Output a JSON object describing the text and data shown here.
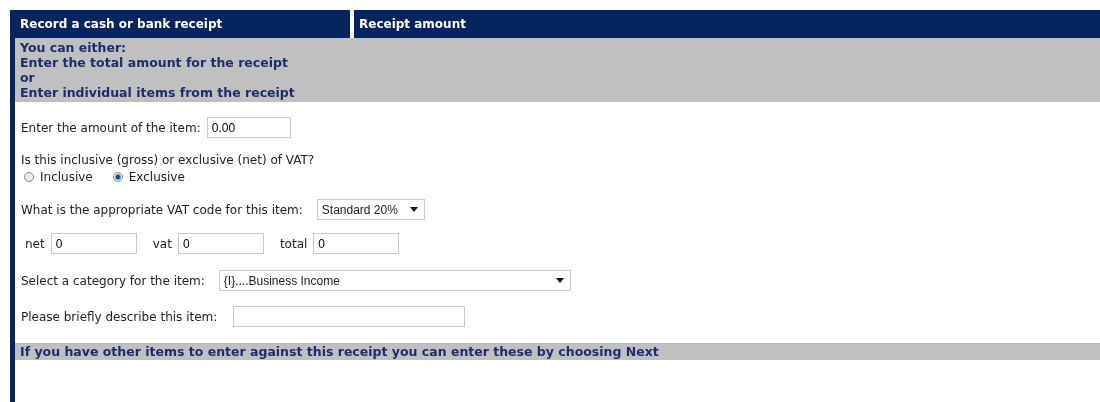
{
  "header": {
    "title": "Record a cash or bank receipt",
    "subtitle": "Receipt amount"
  },
  "intro": [
    "You can either:",
    "Enter the total amount for the receipt",
    "or",
    "Enter individual items from the receipt"
  ],
  "amount": {
    "label": "Enter the amount of the item:",
    "value": "0.00"
  },
  "vat_type": {
    "question": "Is this inclusive (gross) or exclusive (net) of VAT?",
    "options": [
      {
        "label": "Inclusive",
        "selected": false
      },
      {
        "label": "Exclusive",
        "selected": true
      }
    ]
  },
  "vat_code": {
    "label": "What is the appropriate VAT code for this item:",
    "value": "Standard 20%"
  },
  "totals": [
    {
      "label": "net",
      "value": "0"
    },
    {
      "label": "vat",
      "value": "0"
    },
    {
      "label": "total",
      "value": "0"
    }
  ],
  "category": {
    "label": "Select a category for the item:",
    "value": "{I}....Business Income"
  },
  "description": {
    "label": "Please briefly describe this item:"
  },
  "footer": "If you have other items to enter against this receipt you can enter these by choosing Next"
}
